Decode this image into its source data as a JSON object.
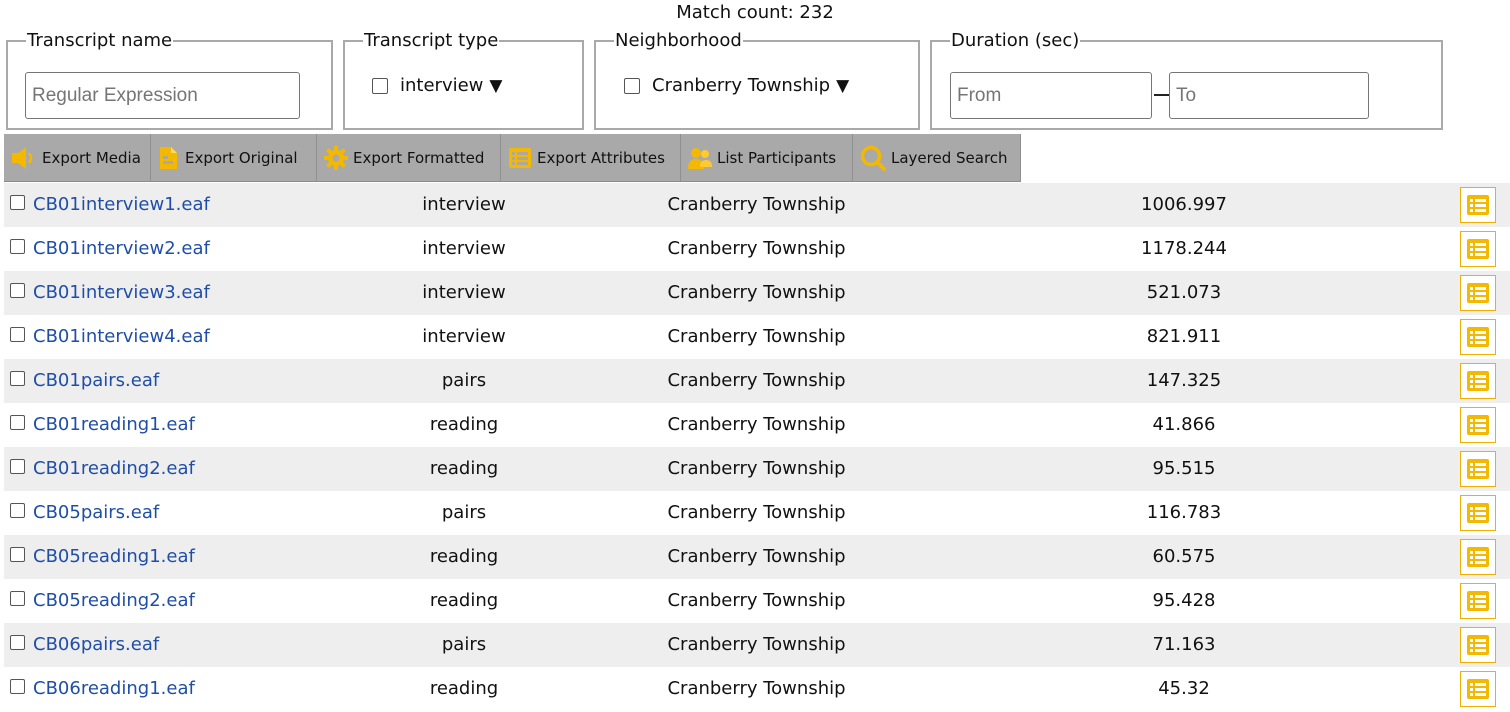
{
  "match_count": "Match count: 232",
  "filters": {
    "transcript_name": {
      "legend": "Transcript name",
      "placeholder": "Regular Expression"
    },
    "transcript_type": {
      "legend": "Transcript type",
      "value": "interview",
      "arrow": "▼"
    },
    "neighborhood": {
      "legend": "Neighborhood",
      "value": "Cranberry Township",
      "arrow": "▼"
    },
    "duration": {
      "legend": "Duration (sec)",
      "from_placeholder": "From",
      "to_placeholder": "To"
    }
  },
  "toolbar": {
    "export_media": "Export Media",
    "export_original": "Export Original",
    "export_formatted": "Export Formatted",
    "export_attributes": "Export Attributes",
    "list_participants": "List Participants",
    "layered_search": "Layered Search"
  },
  "colors": {
    "accent": "#f5b800",
    "link": "#1f4ea8",
    "toolbar": "#a9a9a9",
    "row_alt": "#eeeeee"
  },
  "icons": {
    "export_media": "speaker-icon",
    "export_original": "document-icon",
    "export_formatted": "gear-icon",
    "export_attributes": "table-icon",
    "list_participants": "people-icon",
    "layered_search": "magnifier-icon",
    "row_attributes": "table-icon"
  },
  "rows": [
    {
      "name": "CB01interview1.eaf",
      "type": "interview",
      "neighborhood": "Cranberry Township",
      "duration": "1006.997"
    },
    {
      "name": "CB01interview2.eaf",
      "type": "interview",
      "neighborhood": "Cranberry Township",
      "duration": "1178.244"
    },
    {
      "name": "CB01interview3.eaf",
      "type": "interview",
      "neighborhood": "Cranberry Township",
      "duration": "521.073"
    },
    {
      "name": "CB01interview4.eaf",
      "type": "interview",
      "neighborhood": "Cranberry Township",
      "duration": "821.911"
    },
    {
      "name": "CB01pairs.eaf",
      "type": "pairs",
      "neighborhood": "Cranberry Township",
      "duration": "147.325"
    },
    {
      "name": "CB01reading1.eaf",
      "type": "reading",
      "neighborhood": "Cranberry Township",
      "duration": "41.866"
    },
    {
      "name": "CB01reading2.eaf",
      "type": "reading",
      "neighborhood": "Cranberry Township",
      "duration": "95.515"
    },
    {
      "name": "CB05pairs.eaf",
      "type": "pairs",
      "neighborhood": "Cranberry Township",
      "duration": "116.783"
    },
    {
      "name": "CB05reading1.eaf",
      "type": "reading",
      "neighborhood": "Cranberry Township",
      "duration": "60.575"
    },
    {
      "name": "CB05reading2.eaf",
      "type": "reading",
      "neighborhood": "Cranberry Township",
      "duration": "95.428"
    },
    {
      "name": "CB06pairs.eaf",
      "type": "pairs",
      "neighborhood": "Cranberry Township",
      "duration": "71.163"
    },
    {
      "name": "CB06reading1.eaf",
      "type": "reading",
      "neighborhood": "Cranberry Township",
      "duration": "45.32"
    }
  ]
}
